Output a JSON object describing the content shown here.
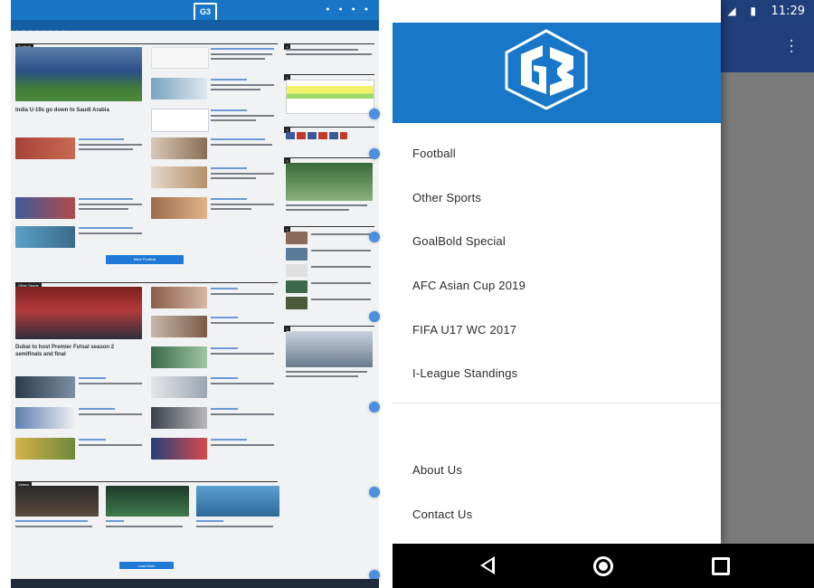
{
  "left": {
    "site": {
      "logo_text": "G3"
    },
    "sections": {
      "football": "Football",
      "other_sports": "Other Sports",
      "videos": "Videos"
    },
    "headlines": {
      "football_main": "India U-19s go down to Saudi Arabia",
      "other_main": "Dubai to host Premier Futsal season 2 semifinals and final"
    },
    "buttons": {
      "more_football": "More Football",
      "load_more": "Load More"
    },
    "colors": {
      "brand": "#1976c7",
      "nav": "#145fa3",
      "footer": "#202c3a"
    }
  },
  "phone": {
    "status": {
      "time": "11:29",
      "app_icon": "whatsapp-icon"
    },
    "drawer": {
      "items": [
        "Football",
        "Other Sports",
        "GoalBold Special",
        "AFC Asian Cup 2019",
        "FIFA U17 WC 2017",
        "I-League Standings"
      ],
      "footer_items": [
        "About Us",
        "Contact Us"
      ]
    },
    "colors": {
      "drawer_header": "#1877c9",
      "status_bar": "#1e3f7a",
      "app_bar": "#233e7c"
    }
  }
}
